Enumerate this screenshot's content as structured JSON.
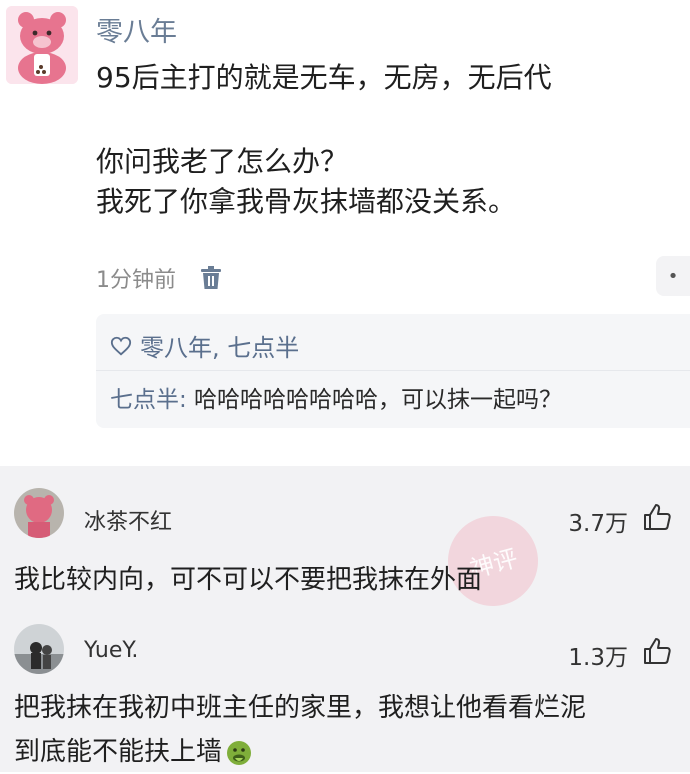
{
  "post": {
    "author": "零八年",
    "lines": [
      "95后主打的就是无车，无房，无后代",
      "你问我老了怎么办？",
      "我死了你拿我骨灰抹墙都没关系。"
    ],
    "time": "1分钟前",
    "likes_text": "零八年, 七点半",
    "reply_author": "七点半:",
    "reply_text": " 哈哈哈哈哈哈哈哈，可以抹一起吗？"
  },
  "comments": [
    {
      "name": "冰茶不红",
      "count": "3.7万",
      "text": "我比较内向，可不可以不要把我抹在外面"
    },
    {
      "name": "YueY.",
      "count": "1.3万",
      "text_line1": "把我抹在我初中班主任的家里，我想让他看看烂泥",
      "text_line2": "到底能不能扶上墙"
    }
  ],
  "watermark": "神评",
  "colors": {
    "author": "#6a7d95",
    "link_blue": "#5a6f8d",
    "comments_bg": "#f2f2f4"
  },
  "icons": [
    "trash-icon",
    "heart-icon",
    "like-icon",
    "more-icon",
    "vomit-emoji-icon"
  ]
}
